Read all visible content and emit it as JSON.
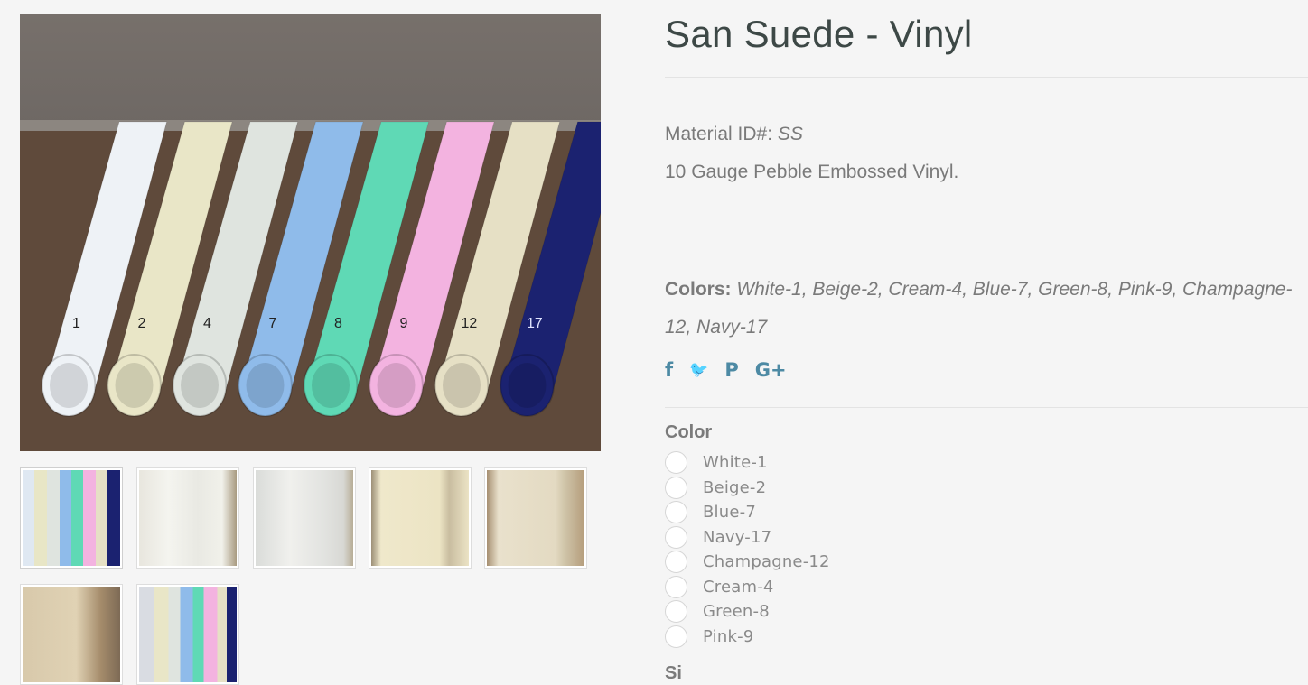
{
  "product": {
    "title": "San Suede - Vinyl",
    "material_id_label": "Material ID#:",
    "material_id_value": "SS",
    "description": "10 Gauge Pebble Embossed Vinyl.",
    "colors_label": "Colors:",
    "colors_value": "White-1, Beige-2, Cream-4, Blue-7, Green-8, Pink-9, Champagne-12, Navy-17"
  },
  "main_image": {
    "rolls": [
      {
        "label": "1",
        "color": "#eef2f6"
      },
      {
        "label": "2",
        "color": "#e9e6c7"
      },
      {
        "label": "4",
        "color": "#dfe4df"
      },
      {
        "label": "7",
        "color": "#8fbbea"
      },
      {
        "label": "8",
        "color": "#5fd9b5"
      },
      {
        "label": "9",
        "color": "#f3b3e0"
      },
      {
        "label": "12",
        "color": "#e6e0c5"
      },
      {
        "label": "17",
        "color": "#1b2270"
      }
    ]
  },
  "thumbnails": [
    {
      "name": "thumbnail-rolls",
      "bg": "linear-gradient(90deg,#dfe8f2 0 12%,#e8e6c6 12% 25%,#dfe4df 25% 38%,#8fbbea 38% 50%,#5fd9b5 50% 62%,#f3b3e0 62% 75%,#e6e0c5 75% 87%,#1b2270 87% 100%)"
    },
    {
      "name": "thumbnail-white-curtain",
      "bg": "linear-gradient(90deg,#e8e6de 0%,#f4f4ef 30%,#e9e9e3 60%,#f1f1ea 85%,#a89a80 100%)"
    },
    {
      "name": "thumbnail-white-curtain-2",
      "bg": "linear-gradient(90deg,#dadcd9 0%,#f0f0ed 35%,#e2e3e0 70%,#d8d8d4 90%,#b7ad96 100%)"
    },
    {
      "name": "thumbnail-cream-curtain",
      "bg": "linear-gradient(90deg,#9c8f77 0%,#efe8cb 10%,#ece4c4 70%,#c9bda0 80%,#ebe3c5 100%)"
    },
    {
      "name": "thumbnail-champagne-curtain",
      "bg": "linear-gradient(90deg,#a58e70 0%,#e9e1cc 12%,#e3dac2 70%,#cfc4a8 80%,#b59d7c 100%)"
    },
    {
      "name": "thumbnail-beige-curtain",
      "bg": "linear-gradient(90deg,#d8c9ab 0%,#e0d2b4 55%,#a58c6b 80%,#7d6a55 100%)"
    },
    {
      "name": "thumbnail-roll-closeup",
      "bg": "linear-gradient(90deg,#d9dce2 0 15%,#e9e6c7 15% 30%,#dfe4df 30% 42%,#8fbbea 42% 55%,#5fd9b5 55% 66%,#f3b3e0 66% 80%,#e6e0c5 80% 90%,#1b2270 90% 100%)"
    }
  ],
  "social": [
    {
      "name": "facebook-icon",
      "glyph": "f"
    },
    {
      "name": "twitter-icon",
      "glyph": "🐦"
    },
    {
      "name": "pinterest-icon",
      "glyph": "P"
    },
    {
      "name": "google-plus-icon",
      "glyph": "G+"
    }
  ],
  "option": {
    "label": "Color",
    "values": [
      "White-1",
      "Beige-2",
      "Blue-7",
      "Navy-17",
      "Champagne-12",
      "Cream-4",
      "Green-8",
      "Pink-9"
    ]
  },
  "next_option_label": "Si"
}
